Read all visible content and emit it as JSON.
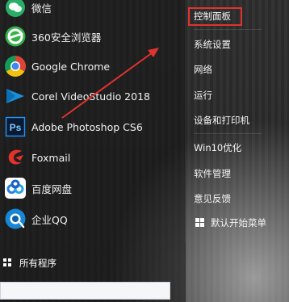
{
  "colors": {
    "accent": "#e0332e",
    "text": "#f2f2f2",
    "chrome_red": "#db4437",
    "chrome_yellow": "#f4c20d",
    "chrome_green": "#0f9d58",
    "chrome_blue": "#4285f4"
  },
  "apps": [
    {
      "label": "微信",
      "icon": "wechat-icon"
    },
    {
      "label": "360安全浏览器",
      "icon": "360-browser-icon"
    },
    {
      "label": "Google Chrome",
      "icon": "chrome-icon"
    },
    {
      "label": "Corel VideoStudio 2018",
      "icon": "corel-videostudio-icon"
    },
    {
      "label": "Adobe Photoshop CS6",
      "icon": "photoshop-icon"
    },
    {
      "label": "Foxmail",
      "icon": "foxmail-icon"
    },
    {
      "label": "百度网盘",
      "icon": "baidu-netdisk-icon"
    },
    {
      "label": "企业QQ",
      "icon": "qq-enterprise-icon"
    }
  ],
  "photoshop_icon_text": "Ps",
  "all_programs": {
    "label": "所有程序",
    "icon": "grid-icon"
  },
  "right_panel": {
    "items": [
      "控制面板",
      "系统设置",
      "网络",
      "运行",
      "设备和打印机",
      "Win10优化",
      "软件管理",
      "意见反馈"
    ],
    "default_menu": {
      "label": "默认开始菜单",
      "icon": "windows-logo-icon"
    }
  },
  "search": {
    "placeholder": ""
  }
}
